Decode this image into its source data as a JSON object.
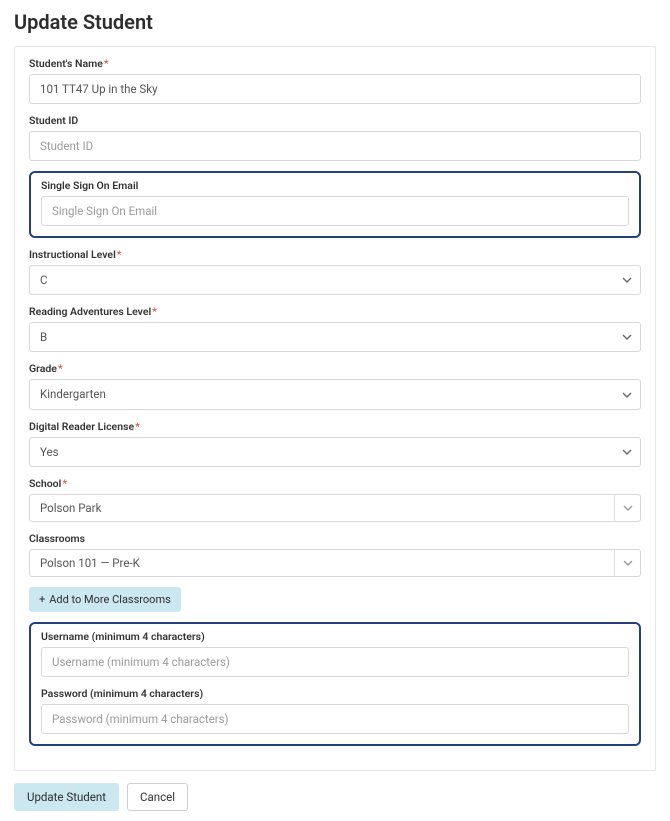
{
  "pageTitle": "Update Student",
  "fields": {
    "studentName": {
      "label": "Student's Name",
      "required": true,
      "value": "101 TT47 Up in the Sky"
    },
    "studentId": {
      "label": "Student ID",
      "required": false,
      "placeholder": "Student ID",
      "value": ""
    },
    "ssoEmail": {
      "label": "Single Sign On Email",
      "required": false,
      "placeholder": "Single Sign On Email",
      "value": ""
    },
    "instructionalLevel": {
      "label": "Instructional Level",
      "required": true,
      "value": "C"
    },
    "readingAdventures": {
      "label": "Reading Adventures Level",
      "required": true,
      "value": "B"
    },
    "grade": {
      "label": "Grade",
      "required": true,
      "value": "Kindergarten"
    },
    "digitalReader": {
      "label": "Digital Reader License",
      "required": true,
      "value": "Yes"
    },
    "school": {
      "label": "School",
      "required": true,
      "value": "Polson Park"
    },
    "classrooms": {
      "label": "Classrooms",
      "required": false,
      "value": "Polson 101 — Pre-K"
    },
    "addClassrooms": {
      "label": "Add to More Classrooms"
    },
    "username": {
      "label": "Username (minimum 4 characters)",
      "placeholder": "Username (minimum 4 characters)",
      "value": ""
    },
    "password": {
      "label": "Password (minimum 4 characters)",
      "placeholder": "Password (minimum 4 characters)",
      "value": ""
    }
  },
  "buttons": {
    "submit": "Update Student",
    "cancel": "Cancel"
  },
  "requiredMarker": "*"
}
